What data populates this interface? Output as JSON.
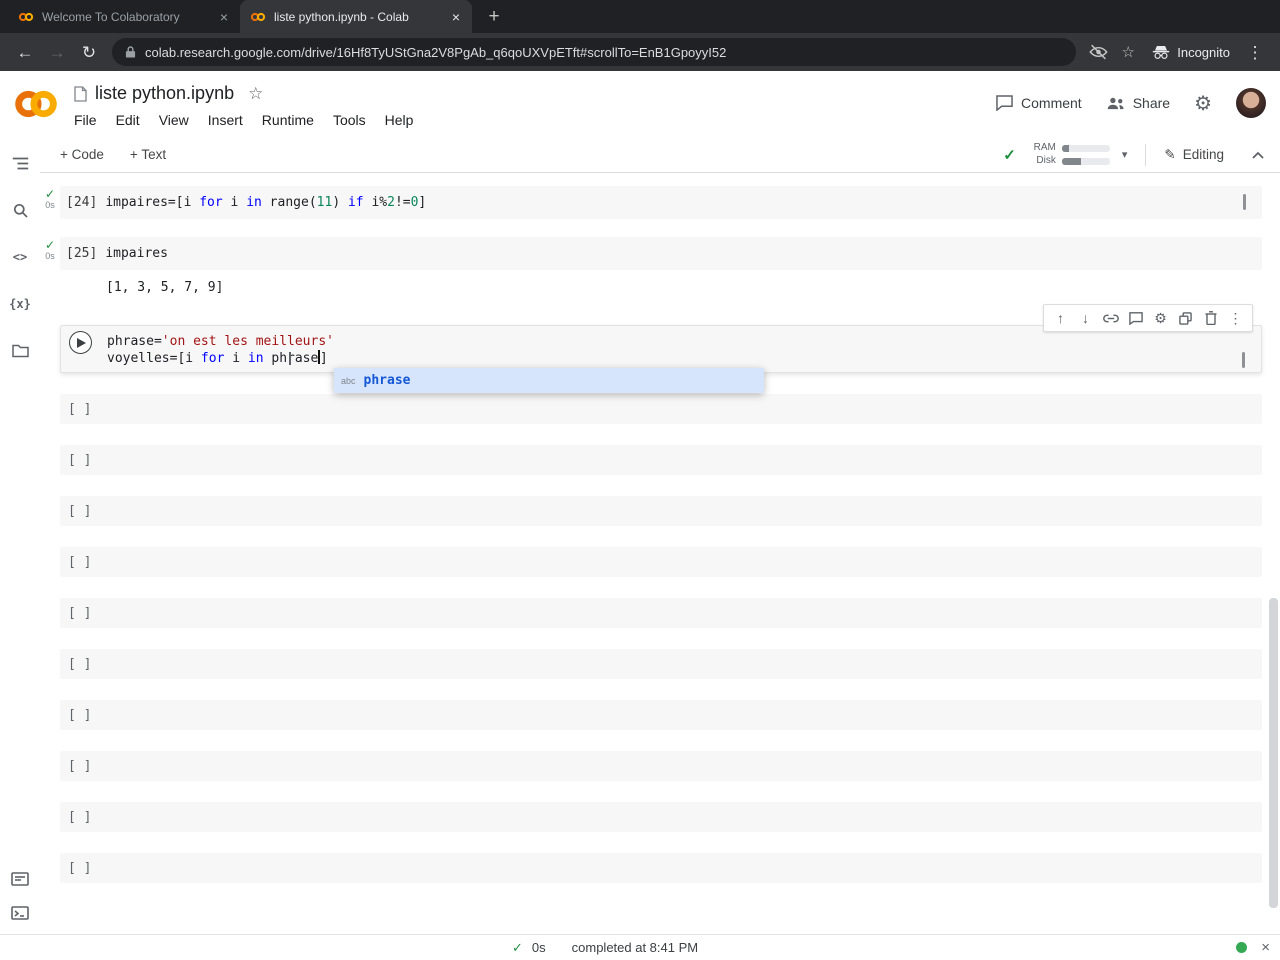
{
  "browser": {
    "tabs": [
      {
        "title": "Welcome To Colaboratory"
      },
      {
        "title": "liste python.ipynb - Colab"
      }
    ],
    "url": "colab.research.google.com/drive/16Hf8TyUStGna2V8PgAb_q6qoUXVpETft#scrollTo=EnB1GpoyyI52",
    "incognito": "Incognito"
  },
  "colab": {
    "title": "liste python.ipynb",
    "menus": [
      "File",
      "Edit",
      "View",
      "Insert",
      "Runtime",
      "Tools",
      "Help"
    ],
    "actions": {
      "comment": "Comment",
      "share": "Share"
    },
    "toolbar": {
      "add_code": "+ Code",
      "add_text": "+ Text",
      "ram": "RAM",
      "disk": "Disk",
      "editing": "Editing"
    }
  },
  "notebook": {
    "cells": [
      {
        "exec_label": "[24]",
        "exec_time": "0s",
        "lines": [
          [
            {
              "t": "impaires=[i ",
              "c": "p"
            },
            {
              "t": "for",
              "c": "k"
            },
            {
              "t": " i ",
              "c": "p"
            },
            {
              "t": "in",
              "c": "k"
            },
            {
              "t": " range(",
              "c": "p"
            },
            {
              "t": "11",
              "c": "n"
            },
            {
              "t": ") ",
              "c": "p"
            },
            {
              "t": "if",
              "c": "k"
            },
            {
              "t": " i%",
              "c": "p"
            },
            {
              "t": "2",
              "c": "n"
            },
            {
              "t": "!=",
              "c": "p"
            },
            {
              "t": "0",
              "c": "n"
            },
            {
              "t": "]",
              "c": "p"
            }
          ]
        ]
      },
      {
        "exec_label": "[25]",
        "exec_time": "0s",
        "lines": [
          [
            {
              "t": "impaires",
              "c": "p"
            }
          ]
        ],
        "output": "[1, 3, 5, 7, 9]"
      },
      {
        "lines": [
          [
            {
              "t": "phrase=",
              "c": "p"
            },
            {
              "t": "'on est les meilleurs'",
              "c": "s"
            }
          ],
          [
            {
              "t": "voyelles=[i ",
              "c": "p"
            },
            {
              "t": "for",
              "c": "k"
            },
            {
              "t": " i ",
              "c": "p"
            },
            {
              "t": "in",
              "c": "k"
            },
            {
              "t": " phrase",
              "c": "p"
            },
            {
              "c": "cursor"
            },
            {
              "t": "]",
              "c": "p"
            }
          ]
        ]
      }
    ],
    "autocomplete": {
      "type_label": "abc",
      "suggestion": "phrase"
    },
    "empty_cell_label": "[ ]",
    "empty_cell_count": 10
  },
  "statusbar": {
    "duration": "0s",
    "message": "completed at 8:41 PM"
  },
  "icons": {
    "back": "←",
    "forward": "→",
    "refresh": "↻",
    "star": "☆",
    "more": "⋮",
    "close": "×",
    "plus": "+",
    "gear": "⚙",
    "check": "✓",
    "arrow_up": "↑",
    "arrow_down": "↓",
    "pencil": "✎",
    "caret_down": "▾",
    "code": "<>",
    "vars": "{x}"
  },
  "colors": {
    "accent_green": "#1e8e3e",
    "keyword": "#0000ff",
    "string": "#a31515",
    "number": "#098658",
    "autocomplete_blue": "#1558d6",
    "colab_orange": "#E8710A",
    "colab_yellow": "#F9AB00"
  }
}
